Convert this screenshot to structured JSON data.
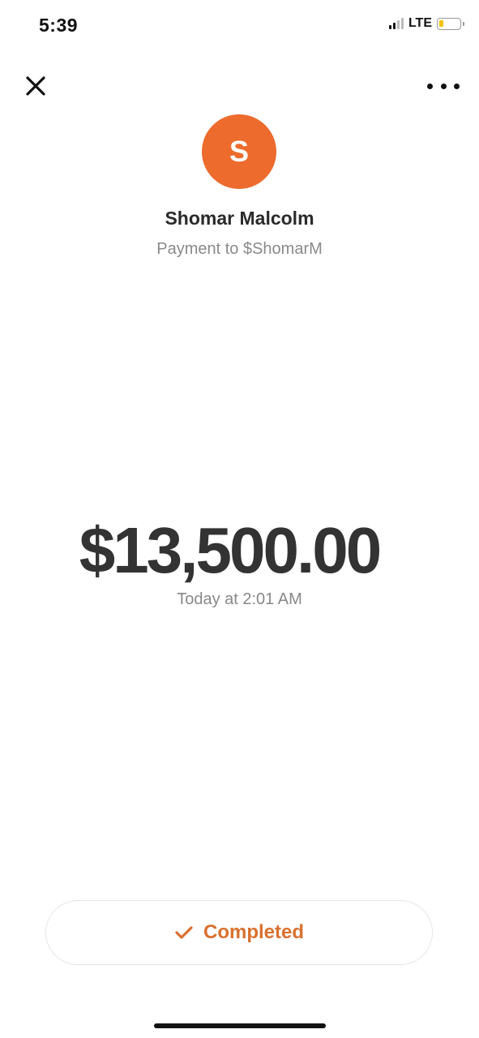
{
  "status_bar": {
    "time": "5:39",
    "network": "LTE",
    "battery_level": 0.2,
    "battery_color": "#f2c200"
  },
  "header": {
    "close_icon": "close-icon",
    "more_icon": "more-options-icon"
  },
  "recipient": {
    "initial": "S",
    "name": "Shomar Malcolm",
    "subtitle": "Payment to $ShomarM",
    "avatar_color": "#ec6b2d"
  },
  "payment": {
    "amount": "$13,500.00",
    "timestamp": "Today at 2:01 AM"
  },
  "status": {
    "icon": "checkmark-icon",
    "label": "Completed",
    "color": "#d9702f"
  }
}
